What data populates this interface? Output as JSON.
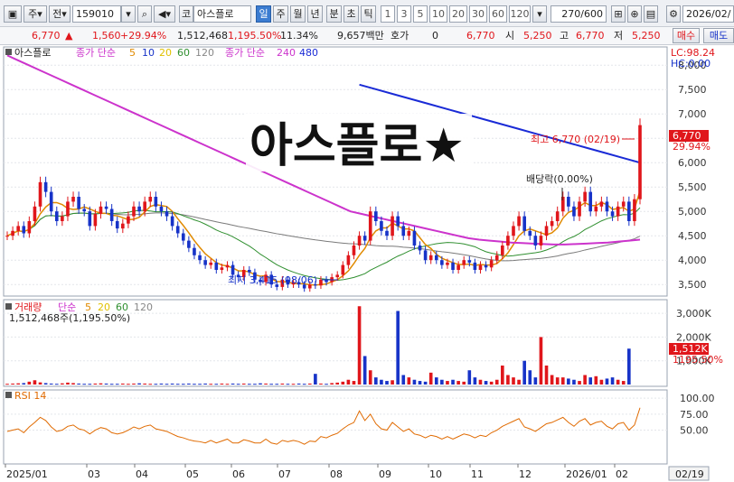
{
  "toolbar": {
    "market": "주",
    "mode": "전",
    "code": "159010",
    "dropdown_icon": "chevron-down-icon",
    "kind": "코",
    "name": "아스플로",
    "periods": [
      "일",
      "주",
      "월",
      "년",
      "분",
      "초",
      "틱"
    ],
    "active_period": "일",
    "minutes": [
      "1",
      "3",
      "5",
      "10",
      "20",
      "30",
      "60",
      "120"
    ],
    "count": "270",
    "count_total": "/600",
    "date": "2026/02/"
  },
  "quote": {
    "price": "6,770",
    "change": "1,560",
    "change_pct": "+29.94%",
    "volume": "1,512,468",
    "vol_ratio": "1,195.50%",
    "turnover": "11.34%",
    "amount": "9,657백만",
    "bid_label": "호가",
    "bid_value": "0",
    "bid_price": "6,770",
    "open_label": "시",
    "open_value": "5,250",
    "high_label": "고",
    "high_value": "6,770",
    "low_label": "저",
    "low_value": "5,250",
    "buy_label": "매수",
    "sell_label": "매도"
  },
  "colors": {
    "up": "#e0161b",
    "down": "#1733c8",
    "ma5": "#e08a00",
    "ma20": "#2f8f2f",
    "ma60": "#7a7a7a",
    "ma240": "#cc33cc",
    "ma480": "#1a2bd6"
  },
  "price_panel": {
    "legend_name": "아스플로",
    "legend_ma_label": "종가 단순",
    "legend_ma_periods": [
      "5",
      "10",
      "20",
      "60",
      "120"
    ],
    "legend_ma2_label": "종가 단순",
    "legend_ma2_periods": [
      "240",
      "480"
    ],
    "lc_label": "LC:98.24",
    "hc_label": "HC:0.00",
    "watermark": "아스플로★",
    "high_annotation": "최고 6,770 (02/19)",
    "low_annotation": "최저 3,415 (08/06)",
    "dividend_label": "배당락(0.00%)",
    "price_tag": "6,770",
    "pct_tag": "29.94%",
    "y_ticks": [
      "8,000",
      "7,500",
      "7,000",
      "6,500",
      "6,000",
      "5,500",
      "5,000",
      "4,500",
      "4,000",
      "3,500"
    ]
  },
  "volume_panel": {
    "legend_title": "거래량",
    "legend_ma_label": "단순",
    "legend_ma_periods": [
      "5",
      "20",
      "60",
      "120"
    ],
    "value_label": "1,512,468주(1,195.50%)",
    "y_ticks": [
      "3,000K",
      "2,000K",
      "1,000K"
    ],
    "vol_tag": "1,512K",
    "ratio_tag": "1195.50%"
  },
  "rsi_panel": {
    "legend": "RSI 14",
    "y_ticks": [
      "100.00",
      "75.00",
      "50.00"
    ]
  },
  "x_axis": {
    "labels": [
      "2025/01",
      "03",
      "04",
      "05",
      "06",
      "07",
      "08",
      "09",
      "10",
      "11",
      "12",
      "2026/01",
      "02"
    ],
    "current": "02/19"
  },
  "chart_data": {
    "type": "candlestick",
    "symbol": "아스플로",
    "period": "daily",
    "price_range": [
      3300,
      8300
    ],
    "high": {
      "value": 6770,
      "date": "02/19"
    },
    "low": {
      "value": 3415,
      "date": "08/06"
    },
    "last_close": 6770,
    "change": 1560,
    "change_pct": 29.94,
    "volume_last": 1512468,
    "volume_range_k": [
      0,
      3500
    ],
    "rsi_range": [
      0,
      110
    ],
    "closes": [
      4500,
      4600,
      4700,
      4550,
      4800,
      5100,
      5600,
      5400,
      5000,
      4800,
      4900,
      5200,
      5300,
      5050,
      5000,
      4700,
      4950,
      5100,
      5050,
      4800,
      4650,
      4750,
      4900,
      5100,
      5000,
      5200,
      5300,
      5100,
      5000,
      4900,
      4700,
      4550,
      4400,
      4250,
      4100,
      4000,
      3900,
      3950,
      3800,
      3850,
      3900,
      3700,
      3650,
      3800,
      3750,
      3600,
      3550,
      3700,
      3500,
      3450,
      3600,
      3500,
      3550,
      3500,
      3420,
      3500,
      3480,
      3600,
      3550,
      3650,
      3700,
      3900,
      4100,
      4300,
      4500,
      4400,
      5000,
      4800,
      4600,
      4500,
      4900,
      4700,
      4500,
      4600,
      4300,
      4200,
      4000,
      4100,
      4000,
      3900,
      3950,
      3800,
      3900,
      4000,
      3950,
      3800,
      3900,
      3850,
      4000,
      4100,
      4300,
      4500,
      4700,
      4900,
      4600,
      4500,
      4300,
      4500,
      4700,
      4800,
      5000,
      5300,
      5100,
      4900,
      5200,
      5400,
      5000,
      5100,
      5200,
      5000,
      4900,
      5100,
      5200,
      4800,
      5250,
      6770
    ],
    "ma240": [
      8200,
      8100,
      8000,
      7900,
      7800,
      7700,
      7600,
      7500,
      7400,
      7300,
      7200,
      7100,
      7000,
      6900,
      6800,
      6700,
      6600,
      6500,
      6400,
      6300,
      6200,
      6100,
      6000,
      5900,
      5800,
      5700,
      5600,
      5500,
      5400,
      5300,
      5200,
      5100,
      5000,
      4950,
      4900,
      4850,
      4800,
      4750,
      4700,
      4650,
      4600,
      4550,
      4500,
      4450,
      4420,
      4400,
      4380,
      4360,
      4350,
      4340,
      4330,
      4320,
      4320,
      4330,
      4340,
      4350,
      4360,
      4380,
      4400,
      4420
    ],
    "ma480": [
      7600,
      7500,
      7400,
      7300,
      7200,
      7100,
      7000,
      6900,
      6800,
      6700,
      6600,
      6500,
      6400,
      6300,
      6200,
      6100,
      6000
    ],
    "volume_k": [
      30,
      40,
      50,
      60,
      120,
      180,
      90,
      60,
      40,
      30,
      50,
      80,
      60,
      40,
      30,
      30,
      40,
      50,
      40,
      30,
      30,
      40,
      30,
      40,
      50,
      40,
      30,
      30,
      40,
      30,
      40,
      30,
      30,
      40,
      30,
      30,
      40,
      30,
      30,
      40,
      30,
      40,
      30,
      40,
      30,
      30,
      50,
      40,
      30,
      30,
      40,
      30,
      30,
      40,
      30,
      40,
      450,
      40,
      30,
      60,
      80,
      120,
      200,
      150,
      3300,
      1200,
      600,
      300,
      200,
      150,
      180,
      3100,
      400,
      300,
      200,
      150,
      120,
      500,
      300,
      200,
      150,
      200,
      150,
      120,
      600,
      300,
      200,
      150,
      120,
      200,
      800,
      400,
      300,
      200,
      1000,
      600,
      300,
      2000,
      800,
      400,
      300,
      300,
      250,
      200,
      150,
      400,
      300,
      350,
      200,
      250,
      300,
      200,
      150,
      1512
    ],
    "rsi": [
      48,
      50,
      52,
      46,
      55,
      62,
      70,
      65,
      55,
      48,
      50,
      56,
      58,
      52,
      50,
      44,
      50,
      54,
      52,
      46,
      44,
      46,
      50,
      55,
      52,
      56,
      58,
      52,
      50,
      48,
      44,
      40,
      38,
      35,
      33,
      32,
      30,
      34,
      30,
      33,
      36,
      30,
      30,
      35,
      33,
      30,
      30,
      36,
      30,
      28,
      34,
      32,
      34,
      32,
      28,
      33,
      32,
      40,
      38,
      42,
      45,
      52,
      58,
      62,
      80,
      65,
      75,
      60,
      52,
      50,
      62,
      55,
      48,
      52,
      44,
      42,
      38,
      42,
      40,
      36,
      40,
      36,
      40,
      44,
      42,
      38,
      42,
      40,
      46,
      50,
      56,
      60,
      64,
      68,
      55,
      52,
      48,
      54,
      60,
      62,
      66,
      70,
      62,
      56,
      64,
      68,
      58,
      62,
      64,
      56,
      52,
      60,
      62,
      50,
      58,
      85
    ]
  }
}
